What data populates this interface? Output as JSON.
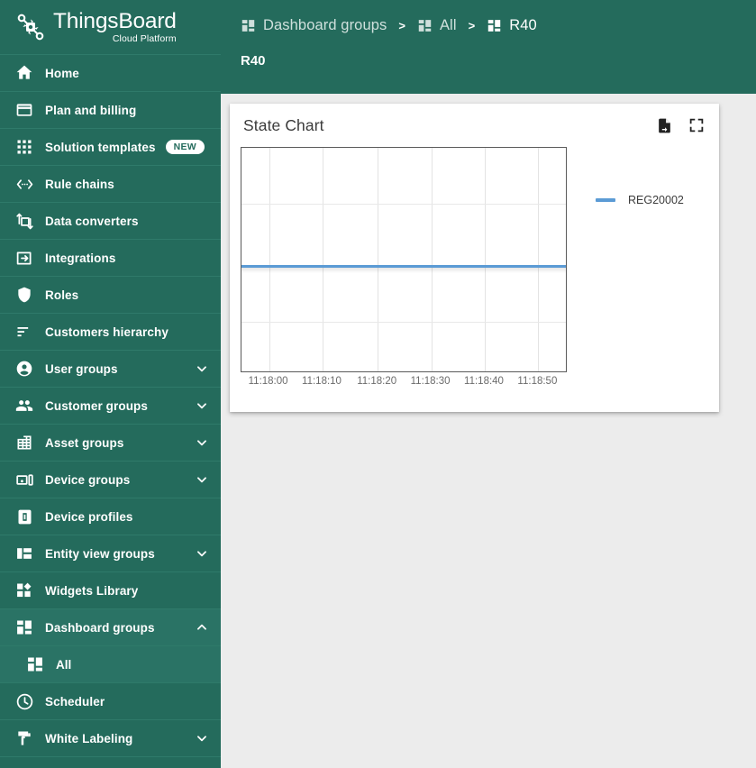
{
  "brand": {
    "title": "ThingsBoard",
    "subtitle": "Cloud Platform",
    "logo_icon": "thingsboard-logo-icon",
    "accent_green": "#246b5c"
  },
  "sidebar": {
    "items": [
      {
        "label": "Home",
        "icon": "home-icon",
        "expandable": false
      },
      {
        "label": "Plan and billing",
        "icon": "credit-card-icon",
        "expandable": false
      },
      {
        "label": "Solution templates",
        "icon": "grid-dots-icon",
        "expandable": false,
        "badge": "NEW"
      },
      {
        "label": "Rule chains",
        "icon": "rule-chain-icon",
        "expandable": false
      },
      {
        "label": "Data converters",
        "icon": "data-converter-icon",
        "expandable": false
      },
      {
        "label": "Integrations",
        "icon": "integrations-icon",
        "expandable": false
      },
      {
        "label": "Roles",
        "icon": "shield-icon",
        "expandable": false
      },
      {
        "label": "Customers hierarchy",
        "icon": "hierarchy-icon",
        "expandable": false
      },
      {
        "label": "User groups",
        "icon": "user-icon",
        "expandable": true,
        "expanded": false
      },
      {
        "label": "Customer groups",
        "icon": "people-icon",
        "expandable": true,
        "expanded": false
      },
      {
        "label": "Asset groups",
        "icon": "building-icon",
        "expandable": true,
        "expanded": false
      },
      {
        "label": "Device groups",
        "icon": "device-icon",
        "expandable": true,
        "expanded": false
      },
      {
        "label": "Device profiles",
        "icon": "device-profile-icon",
        "expandable": false
      },
      {
        "label": "Entity view groups",
        "icon": "entity-view-icon",
        "expandable": true,
        "expanded": false
      },
      {
        "label": "Widgets Library",
        "icon": "widgets-icon",
        "expandable": false
      },
      {
        "label": "Dashboard groups",
        "icon": "dashboard-icon",
        "expandable": true,
        "expanded": true
      },
      {
        "label": "Scheduler",
        "icon": "clock-icon",
        "expandable": false
      },
      {
        "label": "White Labeling",
        "icon": "paint-roller-icon",
        "expandable": true,
        "expanded": false
      }
    ],
    "dashboard_sub_item": {
      "label": "All",
      "icon": "dashboard-icon"
    }
  },
  "header": {
    "breadcrumb": [
      {
        "label": "Dashboard groups",
        "icon": "dashboard-icon",
        "active": false
      },
      {
        "label": "All",
        "icon": "dashboard-icon",
        "active": false
      },
      {
        "label": "R40",
        "icon": "dashboard-icon",
        "active": true
      }
    ],
    "separator": ">",
    "page_title": "R40"
  },
  "widget": {
    "title": "State Chart",
    "export_icon": "export-file-icon",
    "fullscreen_icon": "fullscreen-icon"
  },
  "chart_data": {
    "type": "line",
    "title": "State Chart",
    "xlabel": "",
    "ylabel": "",
    "grid": true,
    "legend_position": "right",
    "series": [
      {
        "name": "REG20002",
        "color": "#5b9bd5",
        "x": [
          "11:18:00",
          "11:18:10",
          "11:18:20",
          "11:18:30",
          "11:18:40",
          "11:18:50"
        ],
        "values": [
          1,
          1,
          1,
          1,
          1,
          1
        ]
      }
    ],
    "x_tick_labels": [
      "11:18:00",
      "11:18:10",
      "11:18:20",
      "11:18:30",
      "11:18:40",
      "11:18:50"
    ],
    "x_tick_positions_pct": [
      8.5,
      25.0,
      42.0,
      58.5,
      75.0,
      91.5
    ],
    "vertical_gridlines_pct": [
      8.5,
      25.0,
      42.0,
      58.5,
      75.0,
      91.5
    ],
    "horizontal_gridlines_pct": [
      25.0,
      52.5,
      78.0
    ],
    "series_line_pct": 52.5,
    "y_tick_labels": []
  }
}
